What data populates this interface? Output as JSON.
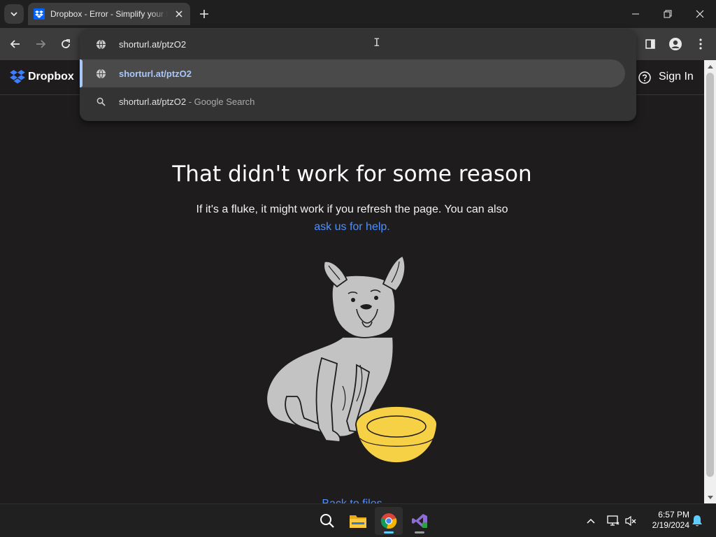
{
  "browser": {
    "tab": {
      "title": "Dropbox - Error - Simplify your life"
    },
    "omnibox": {
      "value": "shorturl.at/ptzO2",
      "suggestions": [
        {
          "text": "shorturl.at/ptzO2",
          "suffix": ""
        },
        {
          "text": "shorturl.at/ptzO2",
          "suffix": " - Google Search"
        }
      ]
    }
  },
  "site": {
    "logo_text": "Dropbox",
    "sign_in": "Sign In",
    "error_title": "That didn't work for some reason",
    "error_description": "If it's a fluke, it might work if you refresh the page. You can also",
    "help_link": "ask us for help.",
    "back_link": "Back to files"
  },
  "taskbar": {
    "apps": [
      "search-icon",
      "file-explorer-icon",
      "chrome-icon",
      "visual-studio-icon"
    ],
    "clock": {
      "time": "6:57 PM",
      "date": "2/19/2024"
    }
  },
  "colors": {
    "page_bg": "#1e1c1c",
    "link": "#4e8fff",
    "accent_blue": "#0061fe",
    "bowl_yellow": "#f7d145",
    "dog_gray": "#c3c3c3"
  }
}
